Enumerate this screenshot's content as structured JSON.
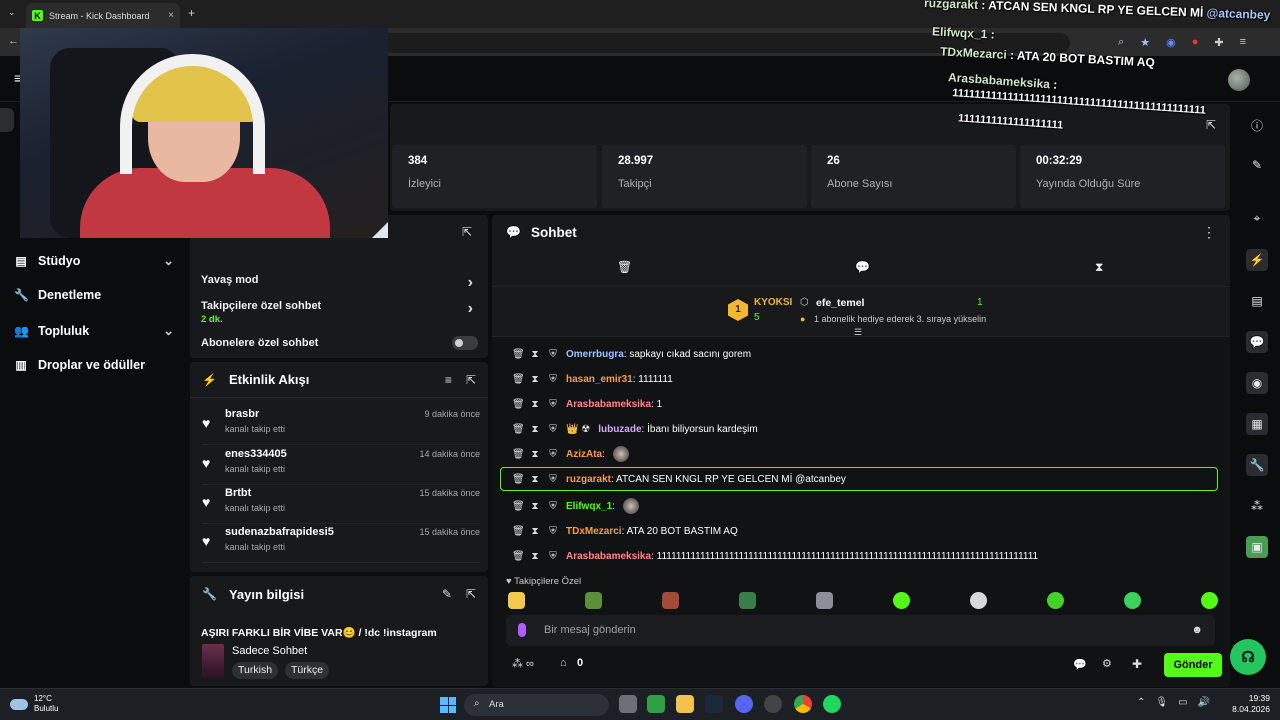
{
  "browser": {
    "tab_title": "Stream - Kick Dashboard",
    "new_tab": "+",
    "close": "×"
  },
  "webcam": {
    "label": "webcam-feed"
  },
  "left_nav": {
    "items": [
      {
        "label": "Stüdyo",
        "icon": "studio-icon",
        "has_chevron": true
      },
      {
        "label": "Denetleme",
        "icon": "wrench-icon",
        "has_chevron": false
      },
      {
        "label": "Topluluk",
        "icon": "community-icon",
        "has_chevron": true
      },
      {
        "label": "Droplar ve ödüller",
        "icon": "drops-icon",
        "has_chevron": false
      }
    ]
  },
  "stats": [
    {
      "value": "384",
      "label": "İzleyici"
    },
    {
      "value": "28.997",
      "label": "Takipçi"
    },
    {
      "value": "26",
      "label": "Abone Sayısı"
    },
    {
      "value": "00:32:29",
      "label": "Yayında Olduğu Süre"
    }
  ],
  "chat_settings": {
    "slow_mode": "Yavaş mod",
    "followers_only": "Takipçilere özel sohbet",
    "followers_only_value": "2 dk.",
    "subscribers_only": "Abonelere özel sohbet"
  },
  "activity": {
    "title": "Etkinlik Akışı",
    "events": [
      {
        "user": "brasbr",
        "desc": "kanalı takip etti",
        "time": "9 dakika önce"
      },
      {
        "user": "enes334405",
        "desc": "kanalı takip etti",
        "time": "14 dakika önce"
      },
      {
        "user": "Brtbt",
        "desc": "kanalı takip etti",
        "time": "15 dakika önce"
      },
      {
        "user": "sudenazbafrapidesi5",
        "desc": "kanalı takip etti",
        "time": "15 dakika önce"
      }
    ]
  },
  "stream_info": {
    "title": "Yayın bilgisi",
    "stream_title": "AŞIRI FARKLI BİR VİBE VAR😊 / !dc !instagram",
    "category": "Sadece Sohbet",
    "tags": [
      "Turkish",
      "Türkçe"
    ]
  },
  "chat": {
    "title": "Sohbet",
    "leaderboard": {
      "rank": "1",
      "name": "KYOKSI",
      "count": "5",
      "gifter": "efe_temel",
      "gifter_count": "1",
      "hint": "1 abonelik hediye ederek 3. sıraya yükselin"
    },
    "messages": [
      {
        "user": "Omerrbugra",
        "color": "#9ec5ff",
        "text": ": sapkayı cıkad sacını gorem",
        "badges": "",
        "emote": false
      },
      {
        "user": "hasan_emir31",
        "color": "#ff9b3d",
        "text": ": 1111111",
        "badges": "",
        "emote": false
      },
      {
        "user": "Arasbabameksika",
        "color": "#ff8a8a",
        "text": ": 1",
        "badges": "",
        "emote": false
      },
      {
        "user": "lubuzade",
        "color": "#d6a5ff",
        "text": ": İbanı biliyorsun kardeşim",
        "badges": "👑 ☢",
        "emote": false
      },
      {
        "user": "AzizAta",
        "color": "#ff9b3d",
        "text": ":",
        "badges": "",
        "emote": true
      },
      {
        "user": "ruzgarakt",
        "color": "#ff9b3d",
        "text": ": ATCAN SEN KNGL RP YE GELCEN Mİ @atcanbey",
        "badges": "",
        "emote": false
      },
      {
        "user": "Elifwqx_1",
        "color": "#53fc18",
        "text": ":",
        "badges": "",
        "emote": true
      },
      {
        "user": "TDxMezarci",
        "color": "#ff9b3d",
        "text": ": ATA 20 BOT BASTIM AQ",
        "badges": "",
        "emote": false
      },
      {
        "user": "Arasbabameksika",
        "color": "#ff8a8a",
        "text": ": 1111111111111111111111111111111111111111111111111111111111111111111111111111111",
        "badges": "",
        "emote": false
      }
    ],
    "followers_only_label": "Takipçilere Özel",
    "input_placeholder": "Bir mesaj gönderin",
    "points": "0",
    "send_label": "Gönder"
  },
  "overlay": [
    {
      "user": "ruzgarakt",
      "text": " : ATCAN SEN KNGL RP YE GELCEN Mİ ",
      "mention": "@atcanbey"
    },
    {
      "user": "Elifwqx_1",
      "text": " :",
      "mention": ""
    },
    {
      "user": "TDxMezarci",
      "text": " : ATA 20 BOT BASTIM AQ",
      "mention": ""
    },
    {
      "user": "Arasbabameksika",
      "text": " :",
      "mention": ""
    },
    {
      "user": "",
      "text": "1111111111111111111111111111111111111111111111",
      "mention": ""
    },
    {
      "user": "",
      "text": "1111111111111111111",
      "mention": ""
    }
  ],
  "taskbar": {
    "temp": "12°C",
    "weather": "Bulutlu",
    "search": "Ara",
    "time": "19:39",
    "date": "8.04.2026"
  },
  "colors": {
    "accent": "#53fc18",
    "panel": "#18191b",
    "background": "#0b0c0d"
  }
}
